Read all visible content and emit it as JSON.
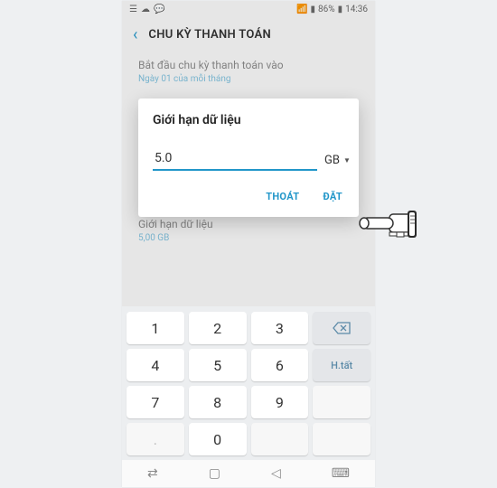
{
  "status": {
    "battery": "86%",
    "time": "14:36"
  },
  "header": {
    "title": "CHU KỲ THANH TOÁN"
  },
  "settings": {
    "row1": {
      "title": "Bắt đầu chu kỳ thanh toán vào",
      "sub": "Ngày 01 của mỗi tháng"
    },
    "row2": {
      "title": "Giới hạn dữ liệu",
      "sub": "5,00 GB"
    }
  },
  "dialog": {
    "title": "Giới hạn dữ liệu",
    "value": "5.0",
    "unit": "GB",
    "cancel": "THOÁT",
    "confirm": "ĐẶT"
  },
  "keyboard": {
    "k1": "1",
    "k2": "2",
    "k3": "3",
    "k4": "4",
    "k5": "5",
    "k6": "6",
    "k7": "7",
    "k8": "8",
    "k9": "9",
    "kdot": ".",
    "k0": "0",
    "done": "H.tất"
  }
}
